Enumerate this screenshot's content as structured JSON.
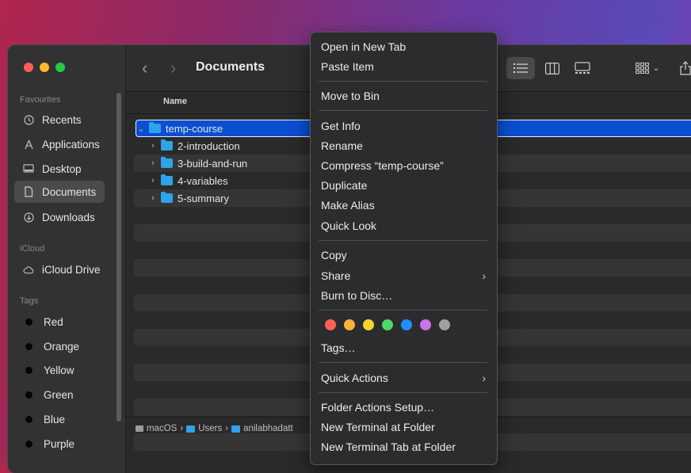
{
  "window": {
    "title": "Documents"
  },
  "sidebar": {
    "favourites_heading": "Favourites",
    "favourites": [
      {
        "label": "Recents",
        "icon": "clock-icon"
      },
      {
        "label": "Applications",
        "icon": "applications-icon"
      },
      {
        "label": "Desktop",
        "icon": "desktop-icon"
      },
      {
        "label": "Documents",
        "icon": "document-icon",
        "selected": true
      },
      {
        "label": "Downloads",
        "icon": "download-icon"
      }
    ],
    "icloud_heading": "iCloud",
    "icloud": [
      {
        "label": "iCloud Drive",
        "icon": "cloud-icon"
      }
    ],
    "tags_heading": "Tags",
    "tags": [
      {
        "label": "Red"
      },
      {
        "label": "Orange"
      },
      {
        "label": "Yellow"
      },
      {
        "label": "Green"
      },
      {
        "label": "Blue"
      },
      {
        "label": "Purple"
      }
    ]
  },
  "list": {
    "column_name": "Name",
    "items": [
      {
        "name": "temp-course",
        "expanded": true,
        "selected": true
      },
      {
        "name": "2-introduction",
        "expanded": false
      },
      {
        "name": "3-build-and-run",
        "expanded": false
      },
      {
        "name": "4-variables",
        "expanded": false
      },
      {
        "name": "5-summary",
        "expanded": false
      }
    ]
  },
  "pathbar": {
    "items": [
      "macOS",
      "Users",
      "anilabhadatt"
    ]
  },
  "context_menu": {
    "open_new_tab": "Open in New Tab",
    "paste_item": "Paste Item",
    "move_to_bin": "Move to Bin",
    "get_info": "Get Info",
    "rename": "Rename",
    "compress": "Compress “temp-course”",
    "duplicate": "Duplicate",
    "make_alias": "Make Alias",
    "quick_look": "Quick Look",
    "copy": "Copy",
    "share": "Share",
    "burn": "Burn to Disc…",
    "tags": "Tags…",
    "quick_actions": "Quick Actions",
    "folder_actions": "Folder Actions Setup…",
    "new_terminal": "New Terminal at Folder",
    "new_terminal_tab": "New Terminal Tab at Folder",
    "tag_colors": [
      "#ff5f57",
      "#fbb03b",
      "#f6d32d",
      "#4cd964",
      "#1e90ff",
      "#c774e8",
      "#a0a0a0"
    ]
  },
  "colors": {
    "accent": "#0b4fd1",
    "folder": "#2ea3ea"
  }
}
